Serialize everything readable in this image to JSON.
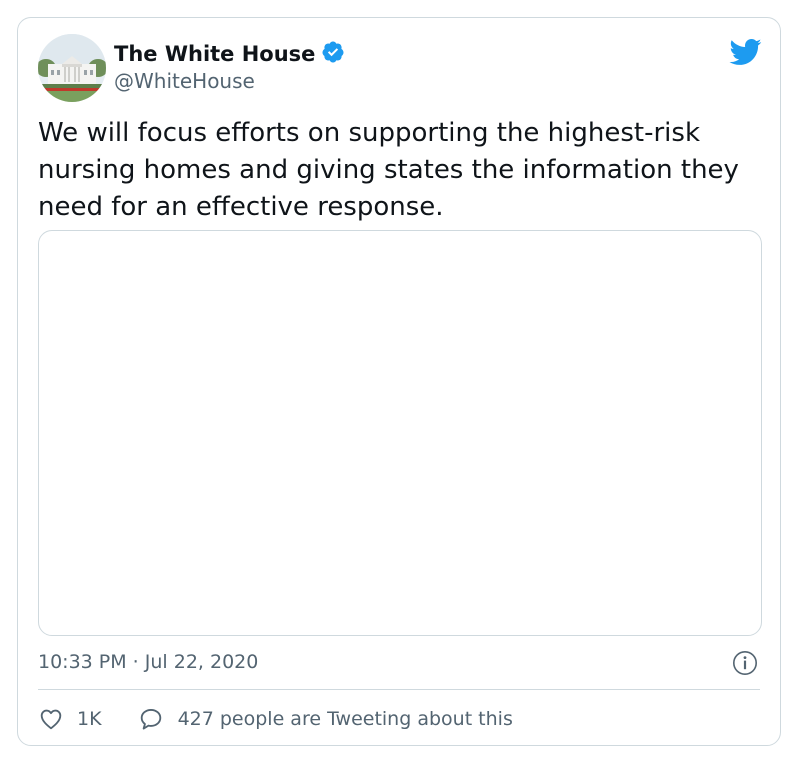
{
  "user": {
    "display_name": "The White House",
    "handle": "@WhiteHouse",
    "verified": true,
    "avatar_icon": "white-house-photo"
  },
  "brand_icon": "twitter-bird-icon",
  "tweet": {
    "text": "We will focus efforts on supporting the highest-risk nursing homes and giving states the information they need for an effective response."
  },
  "meta": {
    "timestamp": "10:33 PM · Jul 22, 2020"
  },
  "actions": {
    "like_count": "1K",
    "reply_text": "427 people are Tweeting about this"
  },
  "colors": {
    "brand_blue": "#1d9bf0",
    "text_primary": "#0f1419",
    "text_secondary": "#536471",
    "border": "#cfd9de"
  }
}
